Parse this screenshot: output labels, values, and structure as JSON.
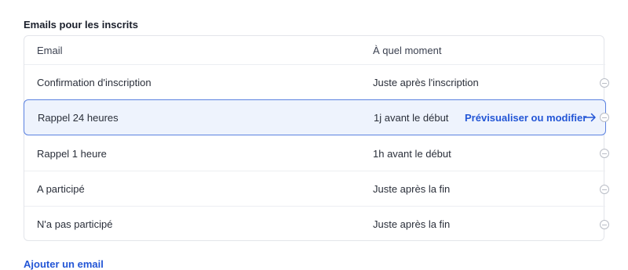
{
  "section": {
    "title": "Emails pour les inscrits"
  },
  "table": {
    "columns": {
      "name": "Email",
      "when": "À quel moment"
    },
    "rows": [
      {
        "name": "Confirmation d'inscription",
        "when": "Juste après l'inscription"
      },
      {
        "name": "Rappel 24 heures",
        "when": "1j avant le début"
      },
      {
        "name": "Rappel 1 heure",
        "when": "1h avant le début"
      },
      {
        "name": "A participé",
        "when": "Juste après la fin"
      },
      {
        "name": "N'a pas participé",
        "when": "Juste après la fin"
      }
    ],
    "selected_action": "Prévisualiser ou modifier"
  },
  "add_link": "Ajouter un email",
  "icons": {
    "row_action": "remove-circle-icon",
    "preview": "arrow-right-icon"
  },
  "colors": {
    "accent": "#2356d6",
    "selected_bg": "#eef3fd",
    "selected_border": "#5b82e0"
  }
}
